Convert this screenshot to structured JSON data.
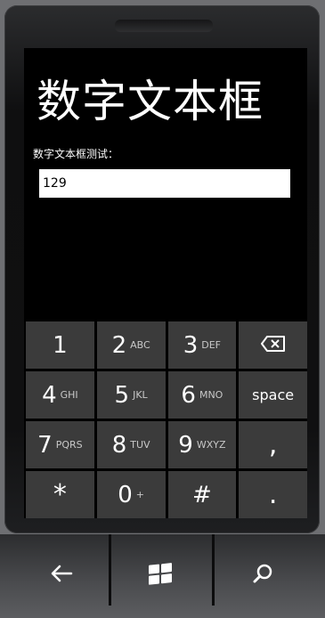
{
  "app": {
    "title": "数字文本框",
    "field_label": "数字文本框测试：",
    "field_value": "129"
  },
  "keypad": {
    "rows": [
      [
        {
          "main": "1",
          "sub": ""
        },
        {
          "main": "2",
          "sub": "ABC"
        },
        {
          "main": "3",
          "sub": "DEF"
        },
        {
          "icon": "backspace-icon"
        }
      ],
      [
        {
          "main": "4",
          "sub": "GHI"
        },
        {
          "main": "5",
          "sub": "JKL"
        },
        {
          "main": "6",
          "sub": "MNO"
        },
        {
          "word": "space"
        }
      ],
      [
        {
          "main": "7",
          "sub": "PQRS"
        },
        {
          "main": "8",
          "sub": "TUV"
        },
        {
          "main": "9",
          "sub": "WXYZ"
        },
        {
          "main": ","
        }
      ],
      [
        {
          "main": "*"
        },
        {
          "main": "0",
          "sub": "+"
        },
        {
          "main": "#"
        },
        {
          "main": "."
        }
      ]
    ],
    "key_1": "1",
    "key_2": "2",
    "key_2_sub": "ABC",
    "key_3": "3",
    "key_3_sub": "DEF",
    "key_4": "4",
    "key_4_sub": "GHI",
    "key_5": "5",
    "key_5_sub": "JKL",
    "key_6": "6",
    "key_6_sub": "MNO",
    "key_space": "space",
    "key_7": "7",
    "key_7_sub": "PQRS",
    "key_8": "8",
    "key_8_sub": "TUV",
    "key_9": "9",
    "key_9_sub": "WXYZ",
    "key_comma": ",",
    "key_star": "*",
    "key_0": "0",
    "key_0_sub": "+",
    "key_hash": "#",
    "key_dot": "."
  },
  "hardware_nav": {
    "back_icon": "back-arrow-icon",
    "start_icon": "windows-logo-icon",
    "search_icon": "search-icon"
  },
  "colors": {
    "screen": "#000000",
    "key": "#3b3b3b",
    "key_sub_text": "#c8c8c8",
    "input_bg": "#ffffff"
  }
}
